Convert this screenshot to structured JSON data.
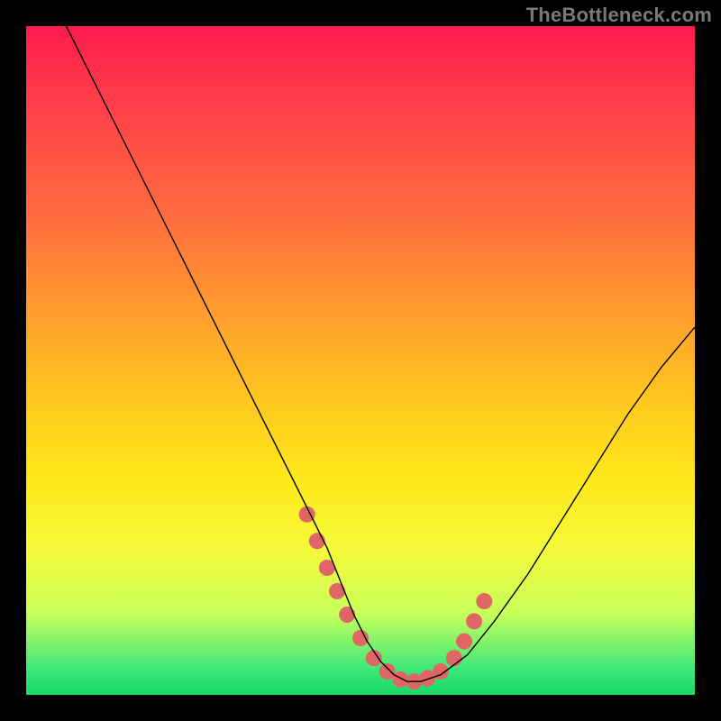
{
  "watermark": "TheBottleneck.com",
  "chart_data": {
    "type": "line",
    "title": "",
    "xlabel": "",
    "ylabel": "",
    "xlim": [
      0,
      100
    ],
    "ylim": [
      0,
      100
    ],
    "series": [
      {
        "name": "curve",
        "x": [
          6,
          10,
          15,
          20,
          25,
          30,
          35,
          40,
          45,
          47,
          49,
          51,
          53,
          55,
          57,
          59,
          62,
          66,
          70,
          75,
          80,
          85,
          90,
          95,
          100
        ],
        "y": [
          100,
          92,
          82,
          72,
          62,
          52,
          42,
          32,
          22,
          17,
          12,
          8,
          5,
          3,
          2,
          2,
          3,
          6,
          11,
          18,
          26,
          34,
          42,
          49,
          55
        ],
        "stroke": "#000000",
        "stroke_width": 1.4
      }
    ],
    "markers": {
      "name": "highlighted-points",
      "x": [
        42,
        43.5,
        45,
        46.5,
        48,
        50,
        52,
        54,
        56,
        58,
        60,
        62,
        64,
        65.5,
        67,
        68.5
      ],
      "y": [
        27,
        23,
        19,
        15.5,
        12,
        8.5,
        5.5,
        3.5,
        2.3,
        2,
        2.5,
        3.5,
        5.5,
        8,
        11,
        14
      ],
      "color": "#e06666",
      "radius": 9
    }
  }
}
